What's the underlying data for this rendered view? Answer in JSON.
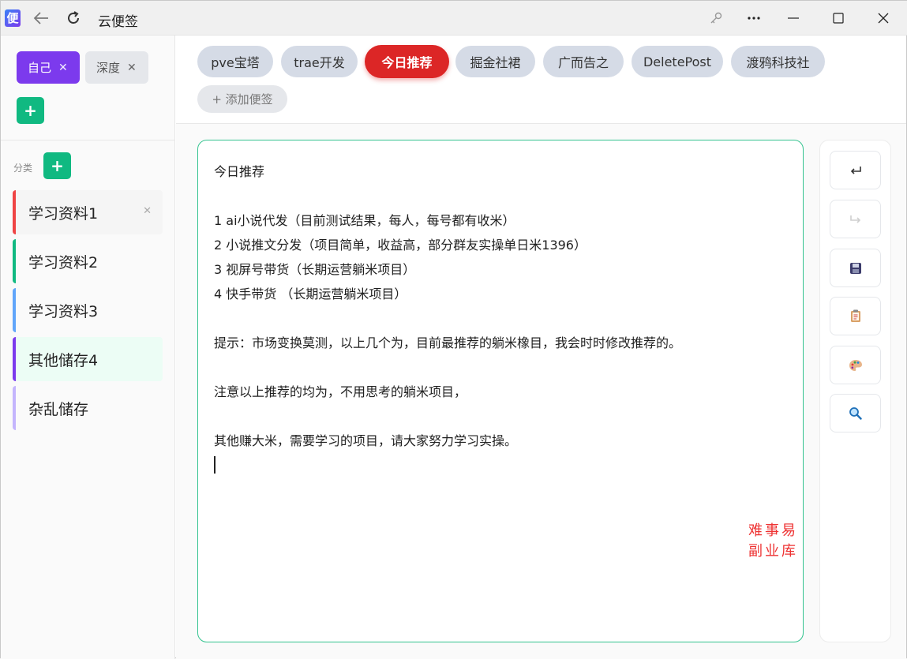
{
  "titlebar": {
    "app_icon_text": "便",
    "title": "云便签"
  },
  "sidebar": {
    "tags": [
      {
        "label": "自己",
        "active": true
      },
      {
        "label": "深度",
        "active": false
      }
    ],
    "category_heading": "分类",
    "categories": [
      {
        "label": "学习资料1",
        "color": "#ef4444"
      },
      {
        "label": "学习资料2",
        "color": "#10b981"
      },
      {
        "label": "学习资料3",
        "color": "#60a5fa"
      },
      {
        "label": "其他储存4",
        "color": "#7c3aed"
      },
      {
        "label": "杂乱储存",
        "color": "#c4b5fd"
      }
    ]
  },
  "notes": {
    "tabs": [
      "pve宝塔",
      "trae开发",
      "今日推荐",
      "掘金社裙",
      "广而告之",
      "DeletePost",
      "渡鸦科技社"
    ],
    "active_tab": "今日推荐",
    "add_label": "+ 添加便签"
  },
  "editor": {
    "lines": [
      "今日推荐",
      "",
      "1 ai小说代发（目前测试结果，每人，每号都有收米）",
      "2  小说推文分发（项目简单，收益高，部分群友实操单日米1396）",
      "3 视屏号带货（长期运营躺米项目）",
      "4 快手带货 （长期运营躺米项目）",
      "",
      "提示：市场变换莫测，以上几个为，目前最推荐的躺米橡目，我会时时修改推荐的。",
      "",
      "注意以上推荐的均为，不用思考的躺米项目，",
      "",
      "其他赚大米，需要学习的项目，请大家努力学习实操。"
    ],
    "watermark": "难事易副业库"
  },
  "colors": {
    "accent_purple": "#7c3aed",
    "accent_green": "#10b981",
    "active_tab_red": "#dc2626"
  }
}
